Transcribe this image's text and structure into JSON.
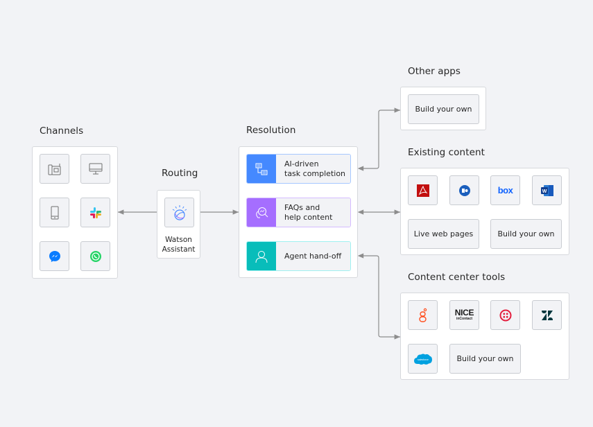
{
  "colors": {
    "background": "#f2f3f6",
    "ai_task": "#4589ff",
    "faq": "#a56eff",
    "agent": "#08bdba",
    "connector": "#8d8d8d"
  },
  "channels": {
    "title": "Channels",
    "items": [
      {
        "icon": "desk-phone-icon",
        "label": "Phone"
      },
      {
        "icon": "desktop-icon",
        "label": "Web"
      },
      {
        "icon": "mobile-icon",
        "label": "Mobile"
      },
      {
        "icon": "slack-icon",
        "label": "Slack"
      },
      {
        "icon": "messenger-icon",
        "label": "Messenger"
      },
      {
        "icon": "whatsapp-icon",
        "label": "WhatsApp"
      }
    ]
  },
  "routing": {
    "title": "Routing",
    "assistant_label": "Watson\nAssistant",
    "icon": "watson-icon"
  },
  "resolution": {
    "title": "Resolution",
    "items": [
      {
        "label": "AI-driven\ntask completion",
        "icon": "workflow-icon",
        "color_key": "ai_task"
      },
      {
        "label": "FAQs and\nhelp content",
        "icon": "faq-search-icon",
        "color_key": "faq"
      },
      {
        "label": "Agent hand-off",
        "icon": "user-icon",
        "color_key": "agent"
      }
    ]
  },
  "other_apps": {
    "title": "Other apps",
    "build_label": "Build your own"
  },
  "existing_content": {
    "title": "Existing content",
    "icons": [
      "adobe-pdf-icon",
      "sharepoint-icon",
      "box-icon",
      "word-icon"
    ],
    "box_text": "box",
    "live_web_label": "Live web pages",
    "build_label": "Build your own"
  },
  "content_center_tools": {
    "title": "Content center tools",
    "icons": [
      "genesys-icon",
      "nice-incontact-icon",
      "twilio-icon",
      "zendesk-icon",
      "salesforce-icon"
    ],
    "nice_text": "NICE",
    "nice_sub": "inContact",
    "salesforce_text": "salesforce",
    "build_label": "Build your own"
  }
}
